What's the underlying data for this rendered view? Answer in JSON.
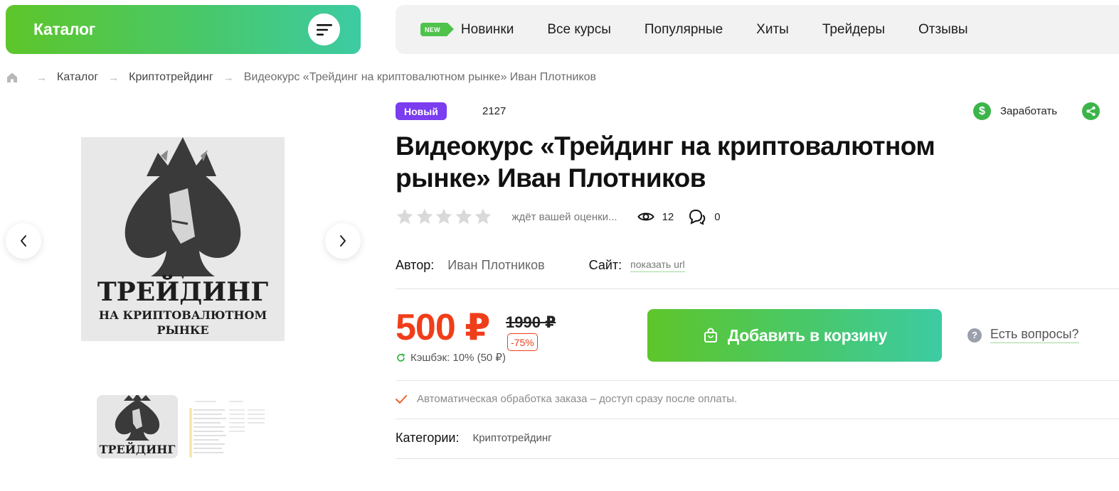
{
  "header": {
    "catalog_label": "Каталог",
    "new_tag": "NEW",
    "nav": [
      "Новинки",
      "Все курсы",
      "Популярные",
      "Хиты",
      "Трейдеры",
      "Отзывы"
    ]
  },
  "breadcrumb": {
    "items": [
      "Каталог",
      "Криптотрейдинг"
    ],
    "current": "Видеокурс «Трейдинг на криптовалютном рынке» Иван Плотников"
  },
  "gallery": {
    "cover_title_line1": "ТРЕЙДИНГ",
    "cover_title_line2": "НА КРИПТОВАЛЮТНОМ",
    "cover_title_line3": "РЫНКЕ"
  },
  "product": {
    "badge": "Новый",
    "sku": "2127",
    "earn_label": "Заработать",
    "title": "Видеокурс «Трейдинг на криптовалютном рынке» Иван Плотников",
    "rating_value": 0,
    "rating_max": 5,
    "rating_text": "ждёт вашей оценки...",
    "views": "12",
    "comments": "0",
    "author_label": "Автор:",
    "author": "Иван Плотников",
    "site_label": "Сайт:",
    "site_link": "показать url",
    "price": "500 ₽",
    "old_price": "1990 ₽",
    "discount": "-75%",
    "cashback": "Кэшбэк: 10% (50 ₽)",
    "cart_button": "Добавить в корзину",
    "questions": "Есть вопросы?",
    "auto_processing": "Автоматическая обработка заказа – доступ сразу после оплаты.",
    "categories_label": "Категории:",
    "category": "Криптотрейдинг"
  },
  "colors": {
    "accent_green": "#48c86a",
    "price_red": "#f03e1a",
    "badge_purple": "#7a3df0"
  }
}
